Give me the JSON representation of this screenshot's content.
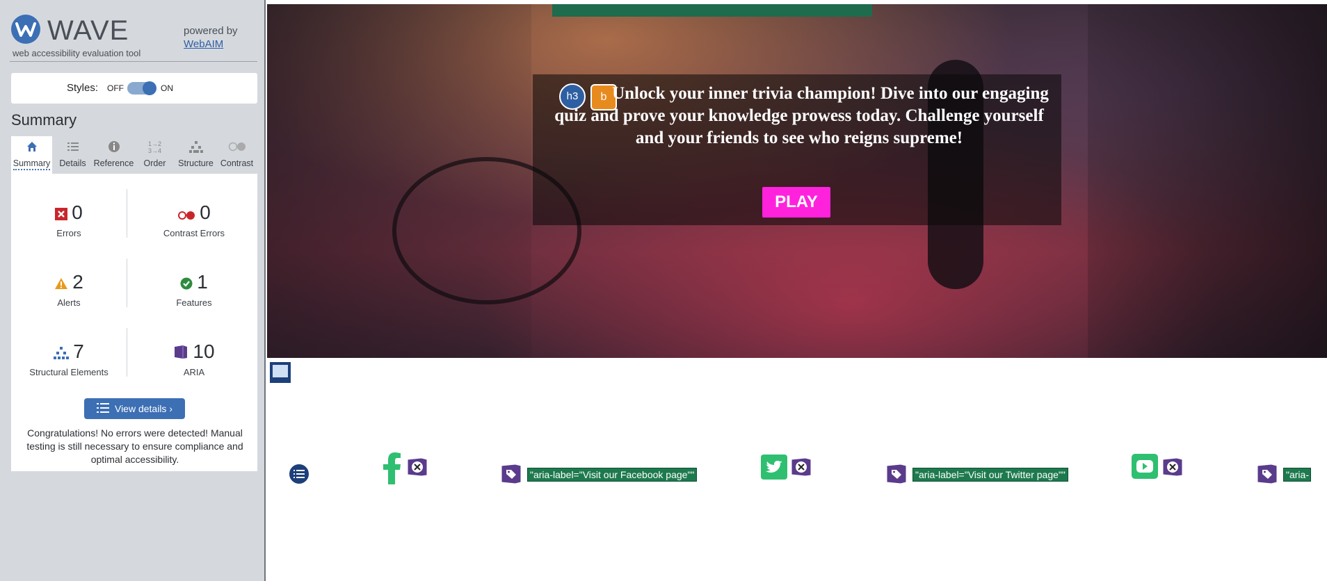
{
  "wave": {
    "logo_text": "WAVE",
    "subtitle": "web accessibility evaluation tool",
    "powered_by": "powered by",
    "webaim_link": "WebAIM",
    "styles_label": "Styles:",
    "styles_off": "OFF",
    "styles_on": "ON",
    "summary_title": "Summary",
    "tabs": [
      {
        "label": "Summary",
        "icon": "home-icon",
        "active": true
      },
      {
        "label": "Details",
        "icon": "list-icon"
      },
      {
        "label": "Reference",
        "icon": "info-icon"
      },
      {
        "label": "Order",
        "icon": "order-icon"
      },
      {
        "label": "Structure",
        "icon": "structure-icon"
      },
      {
        "label": "Contrast",
        "icon": "contrast-icon"
      }
    ],
    "stats": {
      "errors": {
        "count": "0",
        "label": "Errors",
        "icon": "error-icon"
      },
      "contrast_errors": {
        "count": "0",
        "label": "Contrast Errors",
        "icon": "contrast-error-icon"
      },
      "alerts": {
        "count": "2",
        "label": "Alerts",
        "icon": "alert-icon"
      },
      "features": {
        "count": "1",
        "label": "Features",
        "icon": "feature-icon"
      },
      "structural": {
        "count": "7",
        "label": "Structural Elements",
        "icon": "structure-icon"
      },
      "aria": {
        "count": "10",
        "label": "ARIA",
        "icon": "aria-icon"
      }
    },
    "view_details": "View details ›",
    "congrats": "Congratulations! No errors were detected! Manual testing is still necessary to ensure compliance and optimal accessibility."
  },
  "page": {
    "hero_text": "Unlock your inner trivia champion! Dive into our engaging quiz and prove your knowledge prowess today. Challenge yourself and your friends to see who reigns supreme!",
    "h3_badge": "h3",
    "play_button": "PLAY",
    "aria_labels": [
      "\"aria-label=\"Visit our Facebook page\"\"",
      "\"aria-label=\"Visit our Twitter page\"\"",
      "\"aria-"
    ],
    "colors": {
      "play": "#ff22dd",
      "wave_blue": "#3c6fb4",
      "aria_green": "#1e7a4e",
      "aria_purple": "#5a3b8c"
    }
  }
}
